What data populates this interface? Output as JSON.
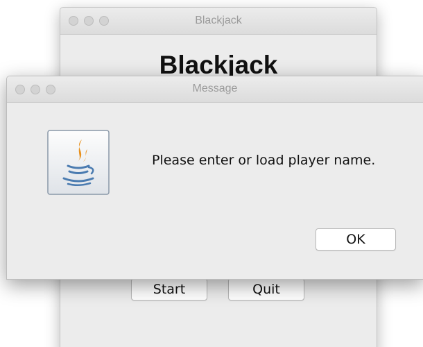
{
  "main_window": {
    "title": "Blackjack",
    "heading": "Blackjack",
    "buttons": {
      "start": "Start",
      "quit": "Quit"
    }
  },
  "dialog": {
    "title": "Message",
    "message": "Please enter or load player name.",
    "ok_label": "OK",
    "icon": "java-icon"
  },
  "colors": {
    "window_bg": "#ececec",
    "title_text": "#9b9b9b",
    "traffic_light": "#d3d3d3",
    "icon_flame": "#e8901c",
    "icon_cup": "#4a7bb0"
  }
}
